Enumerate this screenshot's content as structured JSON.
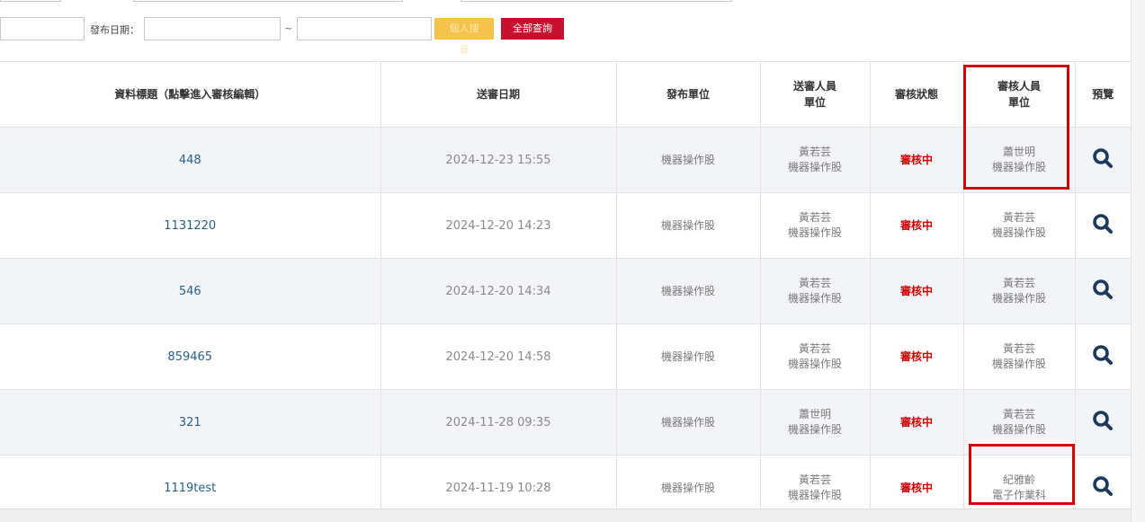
{
  "filter": {
    "publish_date_label": "發布日期：",
    "range_sep": "~",
    "personal_search_label": "個人搜尋",
    "all_query_label": "全部查詢"
  },
  "table": {
    "headers": {
      "title": "資料標題（點擊進入審核編輯）",
      "send_date": "送審日期",
      "publish_unit": "發布單位",
      "sender_line1": "送審人員",
      "sender_line2": "單位",
      "status": "審核狀態",
      "reviewer_line1": "審核人員",
      "reviewer_line2": "單位",
      "preview": "預覽"
    },
    "rows": [
      {
        "title": "448",
        "date": "2024-12-23 15:55",
        "unit": "機器操作股",
        "sender": "黃若芸",
        "sender_unit": "機器操作股",
        "status": "審核中",
        "reviewer": "蕭世明",
        "reviewer_unit": "機器操作股"
      },
      {
        "title": "1131220",
        "date": "2024-12-20 14:23",
        "unit": "機器操作股",
        "sender": "黃若芸",
        "sender_unit": "機器操作股",
        "status": "審核中",
        "reviewer": "黃若芸",
        "reviewer_unit": "機器操作股"
      },
      {
        "title": "546",
        "date": "2024-12-20 14:34",
        "unit": "機器操作股",
        "sender": "黃若芸",
        "sender_unit": "機器操作股",
        "status": "審核中",
        "reviewer": "黃若芸",
        "reviewer_unit": "機器操作股"
      },
      {
        "title": "859465",
        "date": "2024-12-20 14:58",
        "unit": "機器操作股",
        "sender": "黃若芸",
        "sender_unit": "機器操作股",
        "status": "審核中",
        "reviewer": "黃若芸",
        "reviewer_unit": "機器操作股"
      },
      {
        "title": "321",
        "date": "2024-11-28 09:35",
        "unit": "機器操作股",
        "sender": "蕭世明",
        "sender_unit": "機器操作股",
        "status": "審核中",
        "reviewer": "黃若芸",
        "reviewer_unit": "機器操作股"
      },
      {
        "title": "1119test",
        "date": "2024-11-19 10:28",
        "unit": "機器操作股",
        "sender": "黃若芸",
        "sender_unit": "機器操作股",
        "status": "審核中",
        "reviewer": "紀雅齡",
        "reviewer_unit": "電子作業科"
      }
    ]
  },
  "colors": {
    "accent_red": "#c8102e",
    "accent_yellow": "#f5c24b",
    "link_blue": "#2a5f8a",
    "icon_navy": "#1b3a5c",
    "highlight_red": "#d40000"
  }
}
